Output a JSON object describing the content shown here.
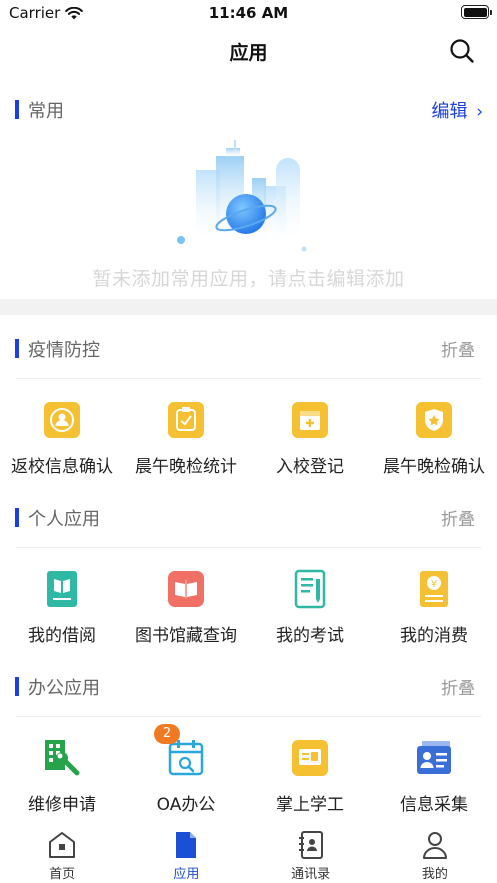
{
  "status_bar": {
    "carrier": "Carrier",
    "time": "11:46 AM"
  },
  "nav": {
    "title": "应用"
  },
  "common": {
    "title": "常用",
    "edit_label": "编辑",
    "empty_text": "暂未添加常用应用，请点击编辑添加"
  },
  "sections": [
    {
      "title": "疫情防控",
      "action": "折叠",
      "items": [
        {
          "label": "返校信息确认",
          "icon": "return-school-icon"
        },
        {
          "label": "晨午晚检统计",
          "icon": "checkup-stats-icon"
        },
        {
          "label": "入校登记",
          "icon": "enter-school-icon"
        },
        {
          "label": "晨午晚检确认",
          "icon": "checkup-confirm-icon"
        }
      ]
    },
    {
      "title": "个人应用",
      "action": "折叠",
      "items": [
        {
          "label": "我的借阅",
          "icon": "book-icon"
        },
        {
          "label": "图书馆藏查询",
          "icon": "library-icon"
        },
        {
          "label": "我的考试",
          "icon": "exam-icon"
        },
        {
          "label": "我的消费",
          "icon": "wallet-icon"
        }
      ]
    },
    {
      "title": "办公应用",
      "action": "折叠",
      "items": [
        {
          "label": "维修申请",
          "icon": "repair-icon"
        },
        {
          "label": "OA办公",
          "icon": "calendar-icon",
          "badge": "2"
        },
        {
          "label": "掌上学工",
          "icon": "student-work-icon"
        },
        {
          "label": "信息采集",
          "icon": "id-card-icon"
        }
      ]
    }
  ],
  "tabs": [
    {
      "label": "首页",
      "icon": "home-icon"
    },
    {
      "label": "应用",
      "icon": "apps-icon",
      "active": true
    },
    {
      "label": "通讯录",
      "icon": "contacts-icon"
    },
    {
      "label": "我的",
      "icon": "profile-icon"
    }
  ],
  "colors": {
    "accent": "#1b3fe0",
    "yellow": "#f6c033",
    "teal": "#2fb8a3",
    "coral": "#f07066",
    "green": "#27a34b",
    "blue": "#3b6fd8",
    "badge": "#f07a22"
  }
}
